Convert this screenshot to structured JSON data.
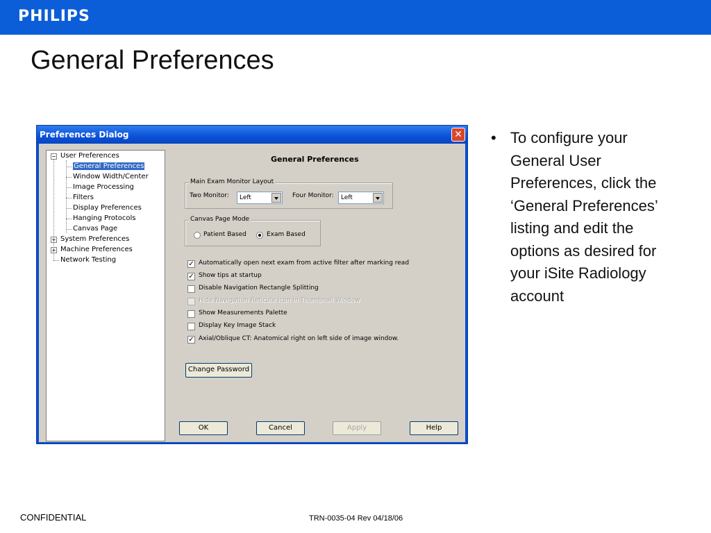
{
  "brand": {
    "logo": "PHILIPS",
    "bar_color": "#0b5ed7"
  },
  "slide": {
    "title": "General Preferences"
  },
  "dialog": {
    "title": "Preferences Dialog",
    "close_icon": "close-icon",
    "tree": {
      "items": [
        {
          "label": "User Preferences",
          "toggle": "⊟",
          "expanded": true
        },
        {
          "label": "General Preferences",
          "selected": true
        },
        {
          "label": "Window Width/Center"
        },
        {
          "label": "Image Processing"
        },
        {
          "label": "Filters"
        },
        {
          "label": "Display Preferences"
        },
        {
          "label": "Hanging Protocols"
        },
        {
          "label": "Canvas Page"
        },
        {
          "label": "System Preferences",
          "toggle": "⊞"
        },
        {
          "label": "Machine Preferences",
          "toggle": "⊞"
        },
        {
          "label": "Network Testing"
        }
      ]
    },
    "panel": {
      "heading": "General Preferences",
      "monitor_layout": {
        "legend": "Main Exam Monitor Layout",
        "two_monitor_label": "Two Monitor:",
        "two_monitor_value": "Left",
        "four_monitor_label": "Four Monitor:",
        "four_monitor_value": "Left"
      },
      "canvas_mode": {
        "legend": "Canvas Page Mode",
        "options": [
          {
            "label": "Patient Based",
            "selected": false
          },
          {
            "label": "Exam Based",
            "selected": true
          }
        ]
      },
      "checkboxes": [
        {
          "label": "Automatically open next exam from active filter after marking read",
          "checked": true,
          "disabled": false
        },
        {
          "label": "Show tips at startup",
          "checked": true,
          "disabled": false
        },
        {
          "label": "Disable Navigation Rectangle Splitting",
          "checked": false,
          "disabled": false
        },
        {
          "label": "Hide Navigation Reticule Icon in Thumbnail Window",
          "checked": false,
          "disabled": true
        },
        {
          "label": "Show Measurements Palette",
          "checked": false,
          "disabled": false
        },
        {
          "label": "Display Key Image Stack",
          "checked": false,
          "disabled": false
        },
        {
          "label": "Axial/Oblique CT: Anatomical right on left side of image window.",
          "checked": true,
          "disabled": false
        }
      ],
      "change_password": "Change Password"
    },
    "buttons": {
      "ok": "OK",
      "cancel": "Cancel",
      "apply": "Apply",
      "help": "Help"
    }
  },
  "bullet": {
    "dot": "•",
    "text": "To configure your General User Preferences, click the ‘General Preferences’ listing and edit the options as desired for your iSite Radiology account"
  },
  "footer": {
    "left": "CONFIDENTIAL",
    "center": "TRN-0035-04 Rev 04/18/06"
  }
}
